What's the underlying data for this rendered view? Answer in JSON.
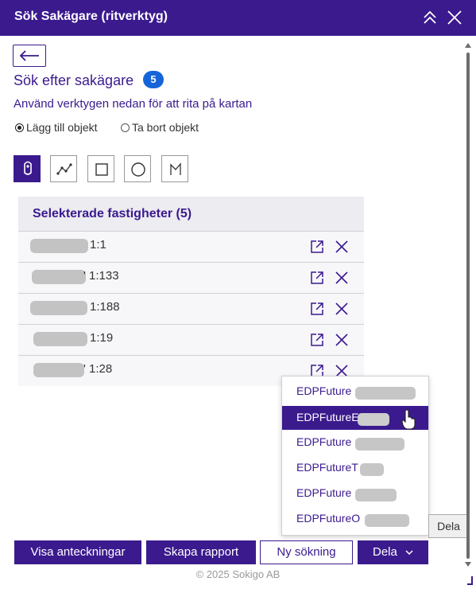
{
  "window": {
    "title": "Sök Sakägare (ritverktyg)"
  },
  "panel": {
    "heading": "Sök efter sakägare",
    "heading_count": "5",
    "instruction": "Använd verktygen nedan för att rita på kartan",
    "mode_options": [
      {
        "label": "Lägg till objekt",
        "selected": true
      },
      {
        "label": "Ta bort objekt",
        "selected": false
      }
    ],
    "draw_tools": [
      {
        "icon": "point-icon",
        "active": true
      },
      {
        "icon": "polyline-icon",
        "active": false
      },
      {
        "icon": "rectangle-icon",
        "active": false
      },
      {
        "icon": "circle-icon",
        "active": false
      },
      {
        "icon": "polygon-icon",
        "active": false
      }
    ]
  },
  "table": {
    "header": "Selekterade fastigheter (5)",
    "rows": [
      {
        "visible_text": "1:1"
      },
      {
        "visible_text": "' 1:133"
      },
      {
        "visible_text": "1:188"
      },
      {
        "visible_text": "1:19"
      },
      {
        "visible_text": "' 1:28"
      }
    ],
    "row_icons": [
      "open-external-icon",
      "close-icon"
    ]
  },
  "share_menu": {
    "items": [
      {
        "label": "EDPFuture",
        "selected": false
      },
      {
        "label": "EDPFutureE",
        "selected": true
      },
      {
        "label": "EDPFuture",
        "selected": false
      },
      {
        "label": "EDPFutureT",
        "selected": false
      },
      {
        "label": "EDPFuture",
        "selected": false
      },
      {
        "label": "EDPFutureO",
        "selected": false
      }
    ],
    "tooltip": "Dela"
  },
  "buttons": {
    "notes": "Visa anteckningar",
    "report": "Skapa rapport",
    "new_search": "Ny sökning",
    "share": "Dela"
  },
  "footer": {
    "copyright": "© 2025 Sokigo AB"
  },
  "colors": {
    "brand": "#3b1a8e",
    "badge": "#1565d8",
    "redaction": "#c3c3c3"
  }
}
